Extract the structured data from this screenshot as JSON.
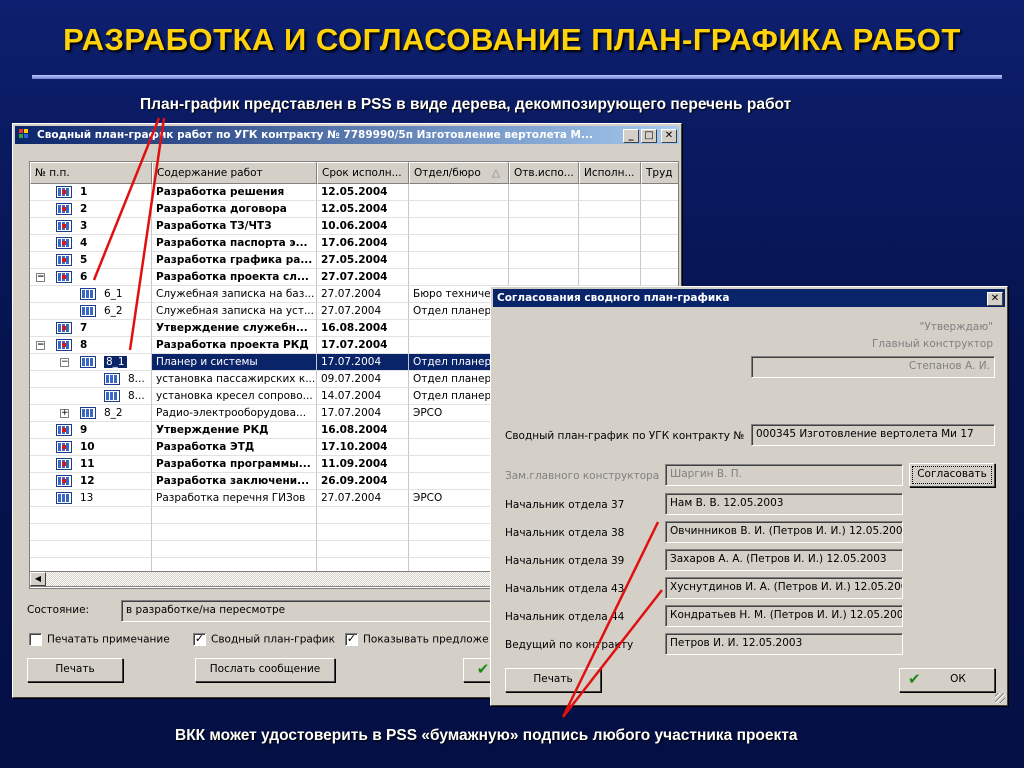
{
  "slide": {
    "title": "РАЗРАБОТКА И СОГЛАСОВАНИЕ ПЛАН-ГРАФИКА РАБОТ",
    "caption_top": "План-график представлен в PSS в виде дерева, декомпозирующего перечень работ",
    "caption_bottom": "ВКК может удостоверить в PSS «бумажную» подпись любого участника проекта"
  },
  "main_window": {
    "title": "Сводный план-график работ по УГК контракту № 7789990/5п Изготовление вертолета М...",
    "columns": [
      "№ п.п.",
      "Содержание работ",
      "Срок исполн...",
      "Отдел/бюро",
      "Отв.испо...",
      "Исполн...",
      "Труд"
    ],
    "rows": [
      {
        "num": "1",
        "content": "Разработка решения",
        "date": "12.05.2004",
        "dept": "",
        "bold": true
      },
      {
        "num": "2",
        "content": "Разработка договора",
        "date": "12.05.2004",
        "dept": "",
        "bold": true
      },
      {
        "num": "3",
        "content": "Разработка ТЗ/ЧТЗ",
        "date": "10.06.2004",
        "dept": "",
        "bold": true
      },
      {
        "num": "4",
        "content": "Разработка паспорта э...",
        "date": "17.06.2004",
        "dept": "",
        "bold": true
      },
      {
        "num": "5",
        "content": "Разработка графика ра...",
        "date": "27.05.2004",
        "dept": "",
        "bold": true
      },
      {
        "num": "6",
        "content": "Разработка проекта сл...",
        "date": "27.07.2004",
        "dept": "",
        "bold": true
      },
      {
        "num": "6_1",
        "content": "Служебная записка на баз...",
        "date": "27.07.2004",
        "dept": "Бюро техническ",
        "bold": false
      },
      {
        "num": "6_2",
        "content": "Служебная записка на уст...",
        "date": "27.07.2004",
        "dept": "Отдел планера",
        "bold": false
      },
      {
        "num": "7",
        "content": "Утверждение служебн...",
        "date": "16.08.2004",
        "dept": "",
        "bold": true
      },
      {
        "num": "8",
        "content": "Разработка проекта РКД",
        "date": "17.07.2004",
        "dept": "",
        "bold": true
      },
      {
        "num": "8_1",
        "content": "Планер и системы",
        "date": "17.07.2004",
        "dept": "Отдел планера",
        "bold": false
      },
      {
        "num": "8...",
        "content": "установка пассажирских к...",
        "date": "09.07.2004",
        "dept": "Отдел планера",
        "bold": false
      },
      {
        "num": "8...",
        "content": "установка кресел сопрово...",
        "date": "14.07.2004",
        "dept": "Отдел планера",
        "bold": false
      },
      {
        "num": "8_2",
        "content": "Радио-электрооборудова...",
        "date": "17.07.2004",
        "dept": "ЭРСО",
        "bold": false
      },
      {
        "num": "9",
        "content": "Утверждение РКД",
        "date": "16.08.2004",
        "dept": "",
        "bold": true
      },
      {
        "num": "10",
        "content": "Разработка ЭТД",
        "date": "17.10.2004",
        "dept": "",
        "bold": true
      },
      {
        "num": "11",
        "content": "Разработка программы...",
        "date": "11.09.2004",
        "dept": "",
        "bold": true
      },
      {
        "num": "12",
        "content": "Разработка заключени...",
        "date": "26.09.2004",
        "dept": "",
        "bold": true
      },
      {
        "num": "13",
        "content": "Разработка перечня ГИЗов",
        "date": "27.07.2004",
        "dept": "ЭРСО",
        "bold": false
      }
    ],
    "status_label": "Состояние:",
    "status_value": "в разработке/на пересмотре",
    "check_print_notes": "Печатать примечание",
    "check_summary": "Сводный план-график",
    "check_show": "Показывать предложе",
    "btn_print": "Печать",
    "btn_send": "Послать сообщение"
  },
  "dialog": {
    "title": "Согласования сводного план-графика",
    "approve_text": "\"Утверждаю\"",
    "chief_label": "Главный конструктор",
    "chief_name": "Степанов А. И.",
    "plan_label": "Сводный план-график по УГК контракту №",
    "plan_value": "000345 Изготовление вертолета Ми 17",
    "deputy_label": "Зам.главного конструктора",
    "deputy_value": "Шаргин В. П.",
    "btn_approve": "Согласовать",
    "signers": [
      {
        "label": "Начальник отдела 37",
        "value": "Нам В. В. 12.05.2003"
      },
      {
        "label": "Начальник отдела 38",
        "value": "Овчинников В. И. (Петров И. И.) 12.05.200"
      },
      {
        "label": "Начальник отдела 39",
        "value": "Захаров А. А. (Петров И. И.) 12.05.2003"
      },
      {
        "label": "Начальник отдела 43",
        "value": "Хуснутдинов И. А. (Петров И. И.) 12.05.200"
      },
      {
        "label": "Начальник отдела 44",
        "value": "Кондратьев Н. М. (Петров И. И.) 12.05.200"
      },
      {
        "label": "Ведущий по контракту",
        "value": "Петров И. И. 12.05.2003"
      }
    ],
    "btn_print": "Печать",
    "btn_ok": "ОК"
  },
  "colors": {
    "title_yellow": "#ffd20a",
    "selection_blue": "#0a246a",
    "annotation_red": "#e01010"
  }
}
